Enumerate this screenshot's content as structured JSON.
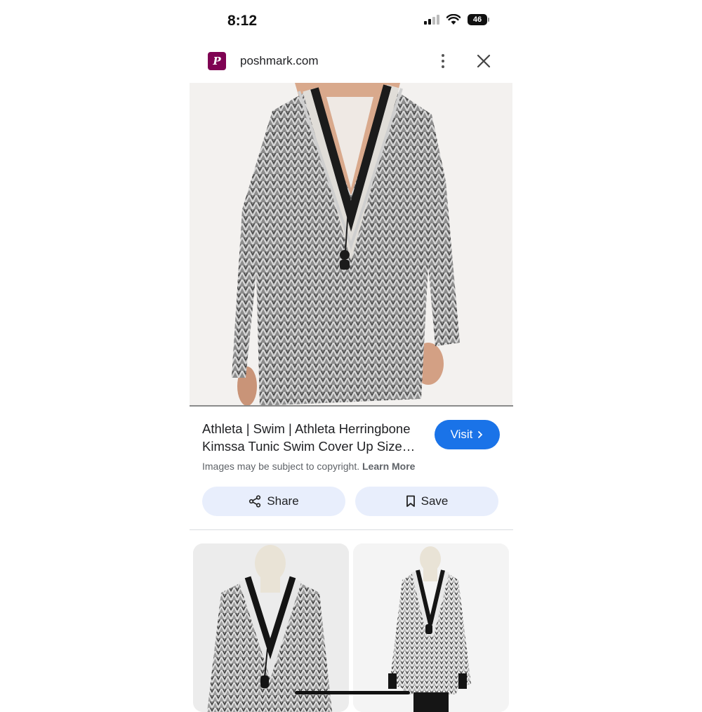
{
  "status_bar": {
    "time": "8:12",
    "battery": "46"
  },
  "source": {
    "site": "poshmark.com",
    "favicon_icon": "poshmark-logo-icon",
    "favicon_color": "#7f0353"
  },
  "result": {
    "title_line1": "Athleta | Swim | Athleta Herringbone",
    "title_line2": "Kimssa Tunic Swim Cover Up Size…",
    "visit_label": "Visit",
    "copyright_text": "Images may be subject to copyright.",
    "learn_more_label": "Learn More"
  },
  "actions": {
    "share_label": "Share",
    "save_label": "Save"
  },
  "colors": {
    "accent": "#1a73e8",
    "button_bg": "#e8eefc"
  }
}
